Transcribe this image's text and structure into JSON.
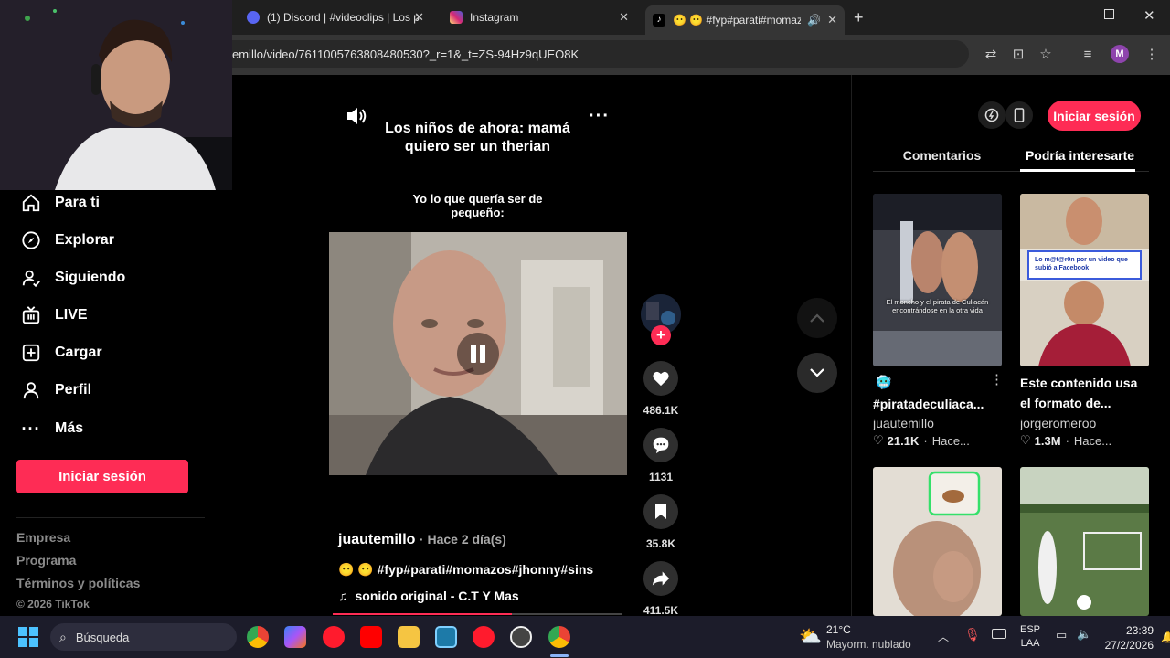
{
  "tabs": [
    {
      "title": "(1) Discord | #videoclips | Los p",
      "icon": "discord-icon"
    },
    {
      "title": "Instagram",
      "icon": "instagram-icon"
    },
    {
      "title": "😶 😶 #fyp#parati#momaz",
      "icon": "tiktok-icon",
      "active": true
    }
  ],
  "address_bar": {
    "url": "emillo/video/7611005763808480530?_r=1&_t=ZS-94Hz9qUEO8K"
  },
  "sidebar": {
    "items": [
      {
        "label": "Para ti",
        "icon": "home-icon"
      },
      {
        "label": "Explorar",
        "icon": "compass-icon"
      },
      {
        "label": "Siguiendo",
        "icon": "following-icon"
      },
      {
        "label": "LIVE",
        "icon": "live-icon"
      },
      {
        "label": "Cargar",
        "icon": "upload-icon"
      },
      {
        "label": "Perfil",
        "icon": "profile-icon"
      },
      {
        "label": "Más",
        "icon": "more-icon"
      }
    ],
    "login_button": "Iniciar sesión",
    "footer": [
      "Empresa",
      "Programa",
      "Términos y políticas"
    ],
    "copyright": "© 2026 TikTok"
  },
  "video": {
    "caption_top": "Los niños de ahora: mamá quiero ser un therian",
    "caption_mid": "Yo lo que quería ser de pequeño:",
    "author": "juautemillo",
    "time": "· Hace 2 día(s)",
    "hashtags": "😶 😶 #fyp#parati#momazos#jhonny#sins",
    "sound": "sonido original - C.T Y Mas"
  },
  "actions": {
    "likes": "486.1K",
    "comments": "1131",
    "saves": "35.8K",
    "shares": "411.5K"
  },
  "right_panel": {
    "login_button": "Iniciar sesión",
    "tabs": [
      "Comentarios",
      "Podría interesarte"
    ],
    "active_tab": 1,
    "cards": [
      {
        "thumb_caption": "El moncho y el pirata de Culiacán encontrándose en la otra vida",
        "emoji": "🥶",
        "title": "#piratadeculiaca...",
        "author": "juautemillo",
        "likes": "21.1K",
        "time": "Hace..."
      },
      {
        "thumb_caption": "Lo m@t@r0n por un video que subió a Facebook",
        "title": "Este contenido usa el formato de...",
        "author": "jorgeromeroo",
        "likes": "1.3M",
        "time": "Hace..."
      }
    ]
  },
  "taskbar": {
    "search_placeholder": "Búsqueda",
    "weather_temp": "21°C",
    "weather_desc": "Mayorm. nublado",
    "lang_line1": "ESP",
    "lang_line2": "LAA",
    "time": "23:39",
    "date": "27/2/2026"
  },
  "colors": {
    "accent": "#fe2c55",
    "background": "#000000"
  }
}
